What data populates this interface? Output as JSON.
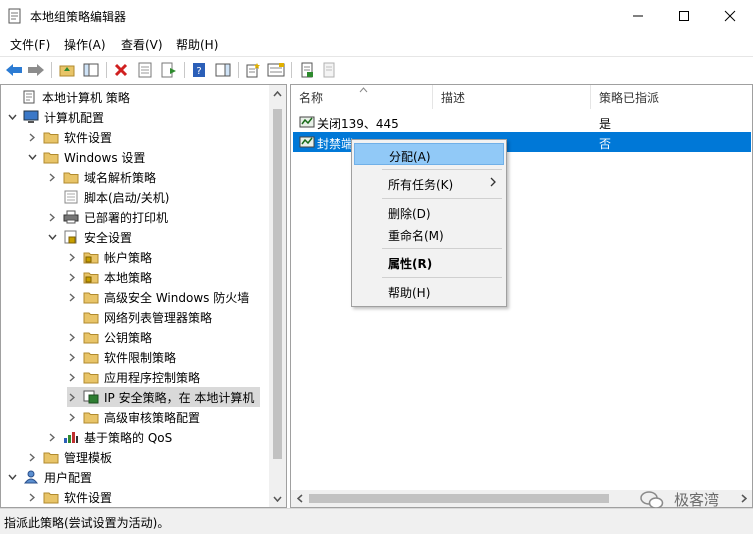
{
  "window": {
    "title": "本地组策略编辑器"
  },
  "menu": [
    "文件(F)",
    "操作(A)",
    "查看(V)",
    "帮助(H)"
  ],
  "tree": [
    {
      "label": "本地计算机 策略",
      "icon": "policy-doc-icon",
      "expander": "none"
    },
    {
      "label": "计算机配置",
      "icon": "computer-icon",
      "expander": "down"
    },
    {
      "label": "软件设置",
      "icon": "folder-icon",
      "expander": "right"
    },
    {
      "label": "Windows 设置",
      "icon": "folder-icon",
      "expander": "down"
    },
    {
      "label": "域名解析策略",
      "icon": "folder-icon",
      "expander": "right"
    },
    {
      "label": "脚本(启动/关机)",
      "icon": "script-icon",
      "expander": "none"
    },
    {
      "label": "已部署的打印机",
      "icon": "printer-icon",
      "expander": "right"
    },
    {
      "label": "安全设置",
      "icon": "security-icon",
      "expander": "down"
    },
    {
      "label": "帐户策略",
      "icon": "folder-lock-icon",
      "expander": "right"
    },
    {
      "label": "本地策略",
      "icon": "folder-lock-icon",
      "expander": "right"
    },
    {
      "label": "高级安全 Windows 防火墙",
      "icon": "folder-icon",
      "expander": "right"
    },
    {
      "label": "网络列表管理器策略",
      "icon": "folder-icon",
      "expander": "none"
    },
    {
      "label": "公钥策略",
      "icon": "folder-icon",
      "expander": "right"
    },
    {
      "label": "软件限制策略",
      "icon": "folder-icon",
      "expander": "right"
    },
    {
      "label": "应用程序控制策略",
      "icon": "folder-icon",
      "expander": "right"
    },
    {
      "label": "IP 安全策略，在 本地计算机",
      "icon": "ip-security-icon",
      "expander": "right"
    },
    {
      "label": "高级审核策略配置",
      "icon": "folder-icon",
      "expander": "right"
    },
    {
      "label": "基于策略的 QoS",
      "icon": "qos-chart-icon",
      "expander": "right"
    },
    {
      "label": "管理模板",
      "icon": "folder-icon",
      "expander": "right"
    },
    {
      "label": "用户配置",
      "icon": "user-icon",
      "expander": "down"
    },
    {
      "label": "软件设置",
      "icon": "folder-icon",
      "expander": "right"
    }
  ],
  "list": {
    "columns": [
      "名称",
      "描述",
      "策略已指派"
    ],
    "rows": [
      {
        "name": "关闭139、445",
        "description": "",
        "assigned": "是"
      },
      {
        "name": "封禁端口",
        "description": "",
        "assigned": "否"
      }
    ]
  },
  "context_menu": {
    "items": [
      {
        "label": "分配(A)"
      },
      {
        "label": "所有任务(K)"
      },
      {
        "label": "删除(D)"
      },
      {
        "label": "重命名(M)"
      },
      {
        "label": "属性(R)"
      },
      {
        "label": "帮助(H)"
      }
    ]
  },
  "status": {
    "text": "指派此策略(尝试设置为活动)。"
  },
  "watermark": {
    "text": "极客湾"
  },
  "colors": {
    "selection": "#0078d7",
    "menu_hover": "#91c9f7",
    "folder": "#e8c468",
    "tree_selected": "#d9d9d9"
  }
}
